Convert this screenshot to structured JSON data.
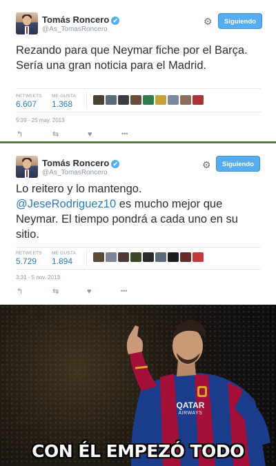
{
  "tweets": [
    {
      "author_name": "Tomás Roncero",
      "handle": "@As_TomasRoncero",
      "verified_icon": "✔",
      "settings_icon": "⚙",
      "follow_label": "Siguiendo",
      "text": "Rezando para que Neymar fiche por el Barça. Sería una gran noticia para el Madrid.",
      "mention": "",
      "retweets_label": "RETWEETS",
      "retweets_value": "6.607",
      "likes_label": "ME GUSTA",
      "likes_value": "1.368",
      "timestamp": "5:39 - 25 may. 2013",
      "thumb_colors": [
        "#4a4036",
        "#5c6b78",
        "#3d3d3d",
        "#6a4c3a",
        "#2e7d4f",
        "#c4a23a",
        "#7a8a9a",
        "#8c6d5a",
        "#aa3333"
      ],
      "actions": {
        "reply": "↰",
        "retweet": "⇆",
        "like": "♥",
        "more": "•••"
      }
    },
    {
      "author_name": "Tomás Roncero",
      "handle": "@As_TomasRoncero",
      "verified_icon": "✔",
      "settings_icon": "⚙",
      "follow_label": "Siguiendo",
      "text_before": "Lo reitero y lo mantengo.",
      "mention": "@JeseRodriguez10",
      "text_after": " es mucho mejor que Neymar. El tiempo pondrá a cada uno en su sitio.",
      "retweets_label": "RETWEETS",
      "retweets_value": "5.729",
      "likes_label": "ME GUSTA",
      "likes_value": "1.894",
      "timestamp": "3:31 - 5 nov. 2013",
      "thumb_colors": [
        "#5a4a3a",
        "#7b8794",
        "#4a3a36",
        "#3a4a2a",
        "#2a2a2a",
        "#5a6a7a",
        "#1e1e1e",
        "#6a2a2a",
        "#c23a3a"
      ],
      "actions": {
        "reply": "↰",
        "retweet": "⇆",
        "like": "♥",
        "more": "•••"
      }
    }
  ],
  "meme": {
    "caption": "CON ÉL EMPEZÓ TODO",
    "shirt_sponsor": "QATAR",
    "shirt_sponsor_sub": "AIRWAYS",
    "colors": {
      "blaugrana_blue": "#1c3c8c",
      "blaugrana_red": "#a3113a"
    }
  },
  "colors": {
    "link": "#2b7bb9",
    "follow_button": "#55acee",
    "muted": "#8899a6"
  }
}
